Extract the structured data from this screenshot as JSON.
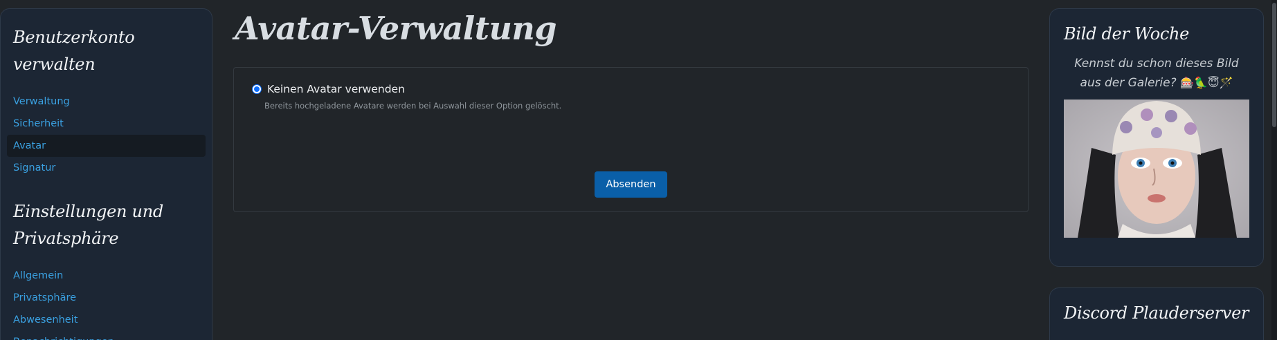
{
  "left_sidebar": {
    "section1_heading": "Benutzerkonto verwalten",
    "section1_items": [
      "Verwaltung",
      "Sicherheit",
      "Avatar",
      "Signatur"
    ],
    "section2_heading": "Einstellungen und Privatsphäre",
    "section2_items": [
      "Allgemein",
      "Privatsphäre",
      "Abwesenheit",
      "Benachrichtigungen"
    ]
  },
  "main": {
    "title": "Avatar-Verwaltung",
    "option_label": "Keinen Avatar verwenden",
    "option_help": "Bereits hochgeladene Avatare werden bei Auswahl dieser Option gelöscht.",
    "submit_label": "Absenden"
  },
  "right_sidebar": {
    "heading": "Bild der Woche",
    "text": "Kennst du schon dieses Bild aus der Galerie?",
    "emojis": "🎰🦜😇🪄",
    "image_icon": "gallery-picture-girl-with-hat",
    "second_heading": "Discord Plauderserver"
  },
  "colors": {
    "background": "#212529",
    "sidebar": "#1c2634",
    "link": "#3aa0e0",
    "button": "#0a5fa8"
  }
}
